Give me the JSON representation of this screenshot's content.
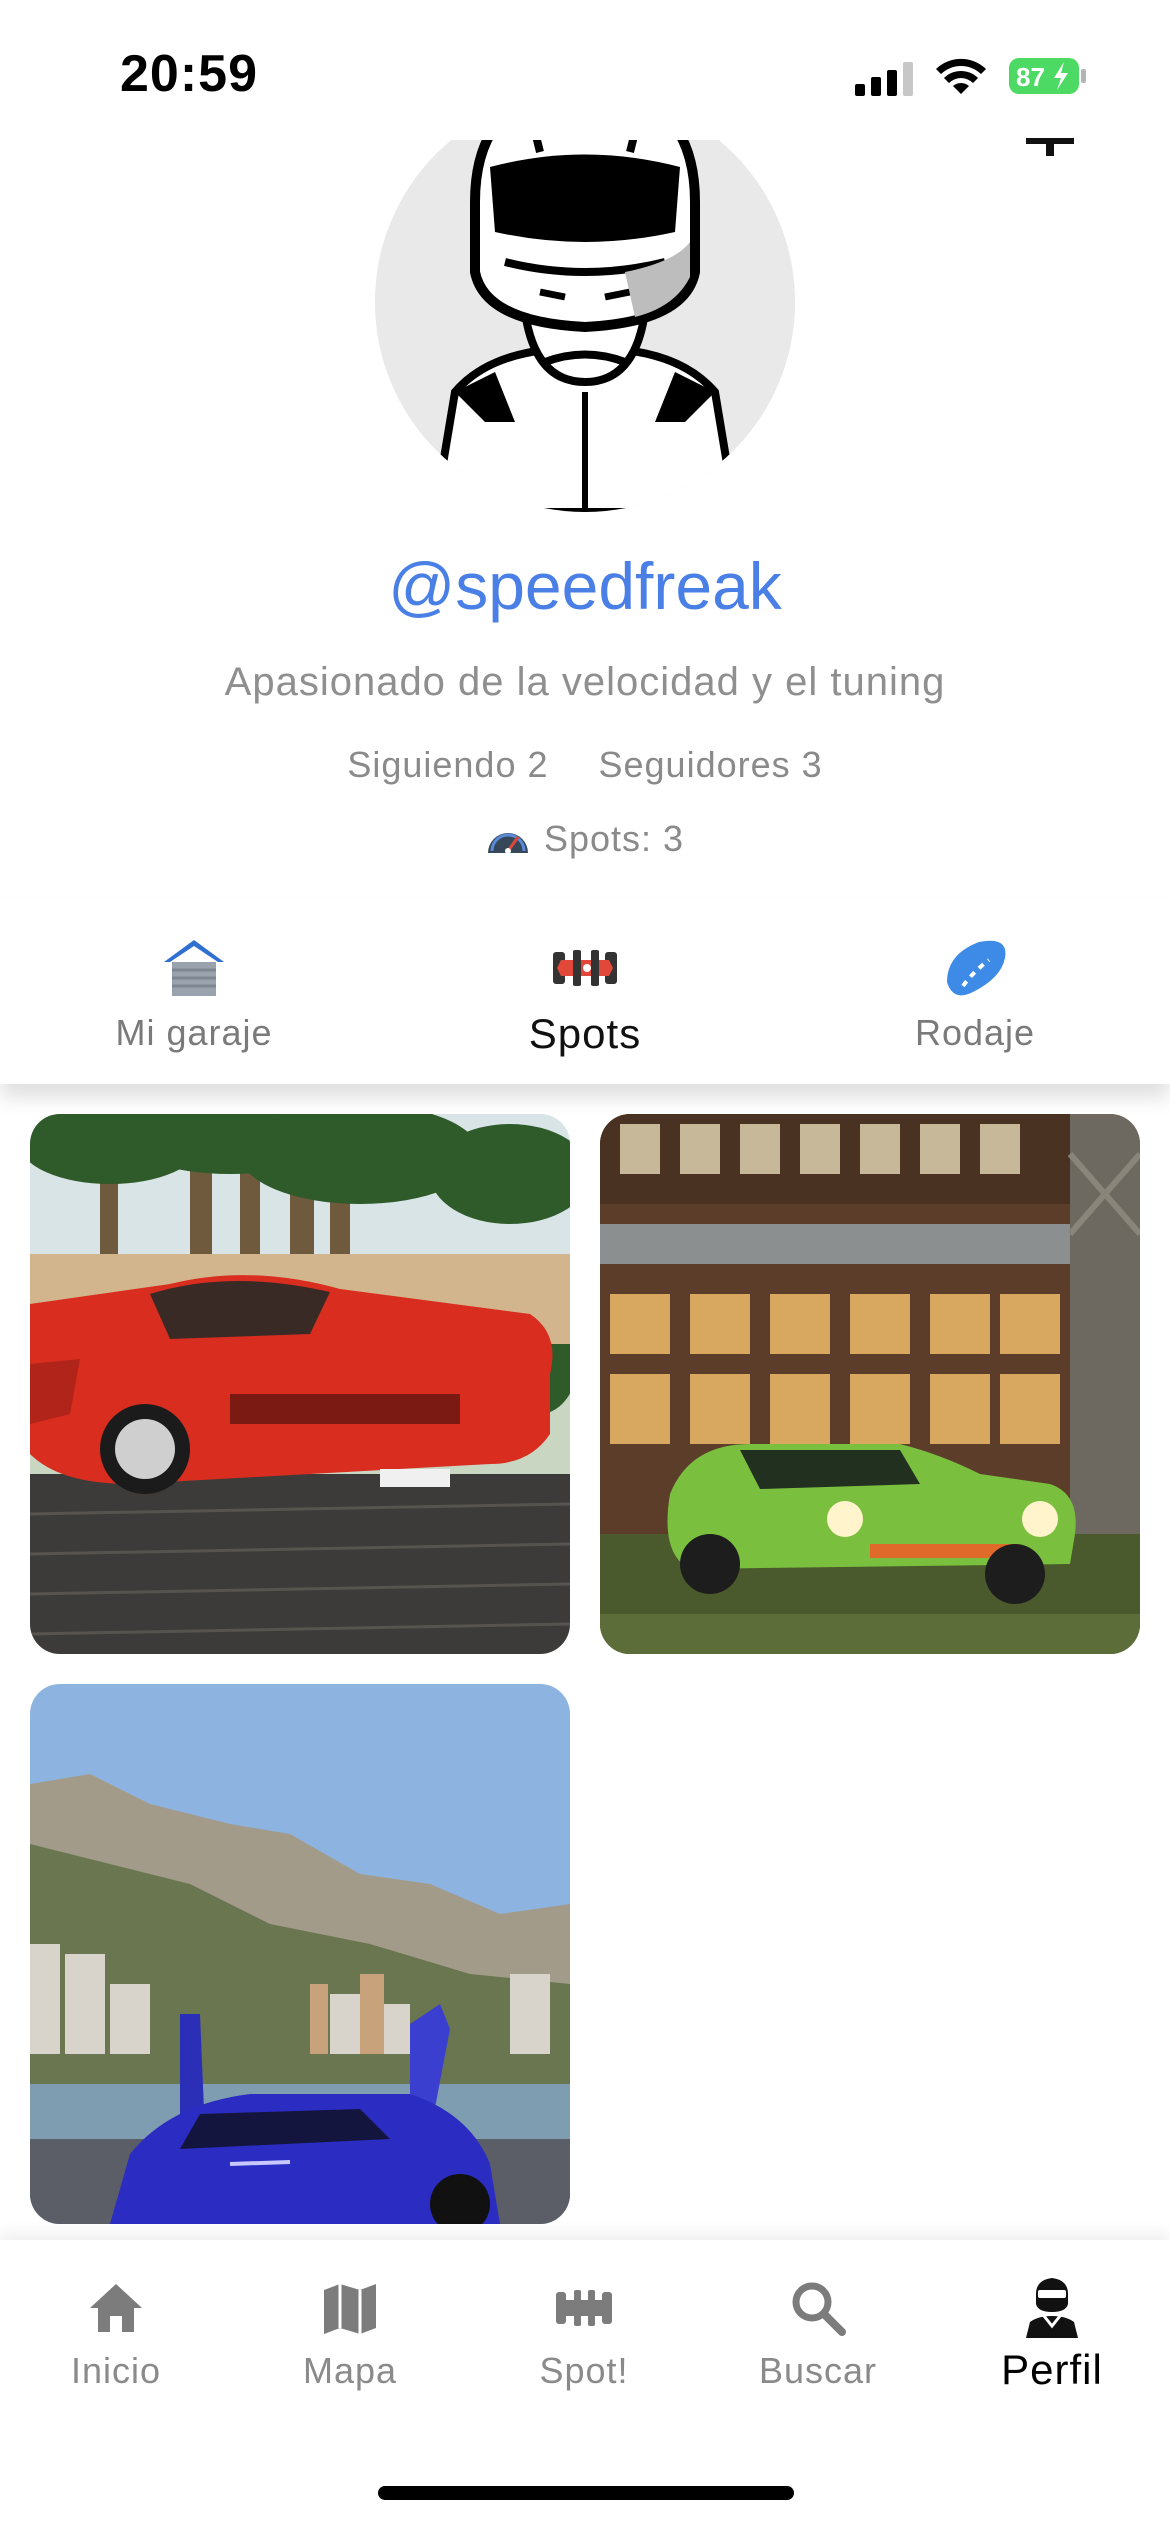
{
  "status_bar": {
    "time": "20:59",
    "battery": "87"
  },
  "profile": {
    "handle": "@speedfreak",
    "bio": "Apasionado de la velocidad y el tuning",
    "following": "Siguiendo 2",
    "followers": "Seguidores 3",
    "spots": "Spots: 3"
  },
  "tabs": [
    {
      "label": "Mi garaje",
      "icon": "garage-icon"
    },
    {
      "label": "Spots",
      "icon": "race-car-icon",
      "active": true
    },
    {
      "label": "Rodaje",
      "icon": "road-icon"
    }
  ],
  "spots_grid": [
    {
      "icon": "red-supercar-photo"
    },
    {
      "icon": "green-classic-car-photo"
    },
    {
      "icon": "blue-supercar-monaco-photo"
    }
  ],
  "bottom_nav": [
    {
      "label": "Inicio",
      "icon": "home-icon"
    },
    {
      "label": "Mapa",
      "icon": "map-icon"
    },
    {
      "label": "Spot!",
      "icon": "race-car-icon"
    },
    {
      "label": "Buscar",
      "icon": "search-icon"
    },
    {
      "label": "Perfil",
      "icon": "helmet-icon",
      "active": true
    }
  ],
  "colors": {
    "accent": "#4a7fe6",
    "text_muted": "#8a8a8a",
    "battery_green": "#4cd964"
  }
}
